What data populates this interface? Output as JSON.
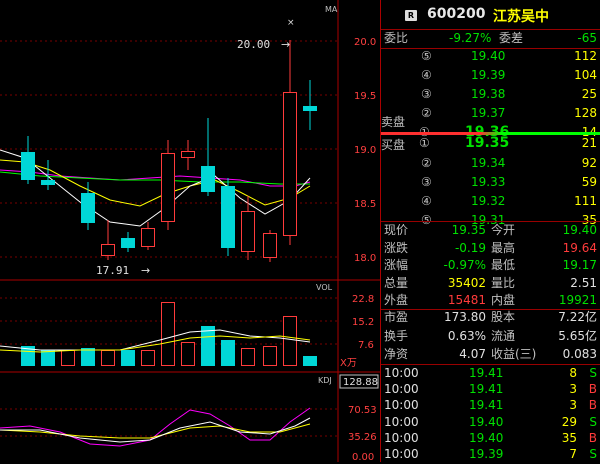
{
  "header": {
    "badge": "R",
    "code": "600200",
    "name": "江苏吴中"
  },
  "chart": {
    "ma_label": "MA",
    "marker": "×",
    "y_ticks": [
      "20.0",
      "19.5",
      "19.0",
      "18.5",
      "18.0"
    ],
    "high_label": "20.00",
    "low_label": "17.91",
    "arrow": "→",
    "vol_label": "VOL",
    "vol_ticks": [
      "22.8",
      "15.2",
      "7.6"
    ],
    "vol_unit": "X万",
    "kdj_label": "KDJ",
    "kdj_highlight": "128.88",
    "kdj_ticks": [
      "70.53",
      "35.26",
      "0.00"
    ],
    "colors": {
      "up": "#ff3b3b",
      "down": "#00d7d7",
      "ma5": "#ffffff",
      "ma10": "#ffff00",
      "ma20": "#ff00ff",
      "ma60": "#00ff00"
    }
  },
  "quote": {
    "weibi_label": "委比",
    "weibi_value": "-9.27%",
    "weicha_label": "委差",
    "weicha_value": "-65",
    "sell_label": "卖盘",
    "buy_label": "买盘",
    "sells": [
      {
        "lvl": "⑤",
        "price": "19.40",
        "vol": "112"
      },
      {
        "lvl": "④",
        "price": "19.39",
        "vol": "104"
      },
      {
        "lvl": "③",
        "price": "19.38",
        "vol": "25"
      },
      {
        "lvl": "②",
        "price": "19.37",
        "vol": "128"
      },
      {
        "lvl": "①",
        "price": "19.36",
        "vol": "14"
      }
    ],
    "buys": [
      {
        "lvl": "①",
        "price": "19.35",
        "vol": "21"
      },
      {
        "lvl": "②",
        "price": "19.34",
        "vol": "92"
      },
      {
        "lvl": "③",
        "price": "19.33",
        "vol": "59"
      },
      {
        "lvl": "④",
        "price": "19.32",
        "vol": "111"
      },
      {
        "lvl": "⑤",
        "price": "19.31",
        "vol": "35"
      }
    ],
    "stats": [
      {
        "l1": "现价",
        "v1": "19.35",
        "l2": "今开",
        "v2": "19.40",
        "c1": "c-grn",
        "c2": "c-grn"
      },
      {
        "l1": "涨跌",
        "v1": "-0.19",
        "l2": "最高",
        "v2": "19.64",
        "c1": "c-grn",
        "c2": "c-red"
      },
      {
        "l1": "涨幅",
        "v1": "-0.97%",
        "l2": "最低",
        "v2": "19.17",
        "c1": "c-grn",
        "c2": "c-grn"
      },
      {
        "l1": "总量",
        "v1": "35402",
        "l2": "量比",
        "v2": "2.51",
        "c1": "c-yel",
        "c2": "c-wht"
      },
      {
        "l1": "外盘",
        "v1": "15481",
        "l2": "内盘",
        "v2": "19921",
        "c1": "c-red",
        "c2": "c-grn"
      }
    ],
    "stats2": [
      {
        "l1": "市盈",
        "v1": "173.80",
        "l2": "股本",
        "v2": "7.22亿"
      },
      {
        "l1": "换手",
        "v1": "0.63%",
        "l2": "流通",
        "v2": "5.65亿"
      },
      {
        "l1": "净资",
        "v1": "4.07",
        "l2": "收益(三)",
        "v2": "0.083"
      }
    ],
    "ticks": [
      {
        "time": "10:00",
        "price": "19.41",
        "vol": "8",
        "dir": "S",
        "pc": "c-grn",
        "dc": "c-grn"
      },
      {
        "time": "10:00",
        "price": "19.41",
        "vol": "3",
        "dir": "B",
        "pc": "c-grn",
        "dc": "c-red"
      },
      {
        "time": "10:00",
        "price": "19.41",
        "vol": "3",
        "dir": "B",
        "pc": "c-grn",
        "dc": "c-red"
      },
      {
        "time": "10:00",
        "price": "19.40",
        "vol": "29",
        "dir": "S",
        "pc": "c-grn",
        "dc": "c-grn"
      },
      {
        "time": "10:00",
        "price": "19.40",
        "vol": "35",
        "dir": "B",
        "pc": "c-grn",
        "dc": "c-red"
      },
      {
        "time": "10:00",
        "price": "19.39",
        "vol": "7",
        "dir": "S",
        "pc": "c-grn",
        "dc": "c-grn"
      }
    ]
  }
}
